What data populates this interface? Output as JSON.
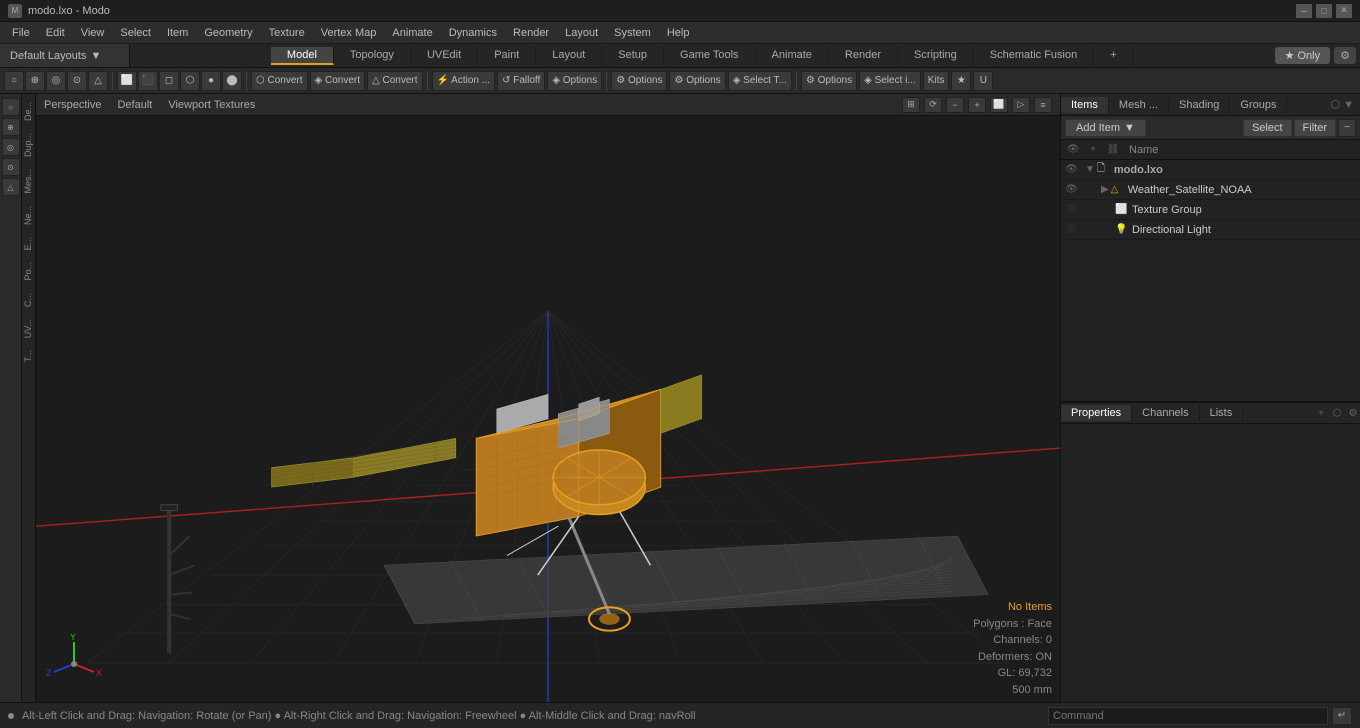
{
  "titlebar": {
    "icon": "☰",
    "title": "modo.lxo - Modo",
    "minimize": "─",
    "maximize": "□",
    "close": "✕"
  },
  "menubar": {
    "items": [
      "File",
      "Edit",
      "View",
      "Select",
      "Item",
      "Geometry",
      "Texture",
      "Vertex Map",
      "Animate",
      "Dynamics",
      "Render",
      "Layout",
      "System",
      "Help"
    ]
  },
  "layout_dropdown": {
    "label": "Default Layouts",
    "arrow": "▼"
  },
  "main_tabs": {
    "items": [
      "Model",
      "Topology",
      "UVEdit",
      "Paint",
      "Layout",
      "Setup",
      "Game Tools",
      "Animate",
      "Render",
      "Scripting",
      "Schematic Fusion"
    ],
    "active": "Model",
    "add_icon": "+",
    "only_label": "★  Only",
    "gear_label": "⚙"
  },
  "toolbar": {
    "groups": [
      {
        "buttons": [
          "○",
          "⊕",
          "◎",
          "⊙",
          "△"
        ]
      },
      {
        "buttons": [
          "⬜",
          "⬛",
          "◻",
          "⬡",
          "●",
          "⬤"
        ]
      },
      {
        "convert_buttons": [
          "Convert",
          "Convert",
          "Convert"
        ]
      },
      {
        "action_buttons": [
          "⚡ Action ...",
          "↺ Falloff",
          "◈ Options"
        ]
      },
      {
        "option_buttons": [
          "⚙ Options",
          "⚙ Options",
          "◈ Select T..."
        ]
      },
      {
        "right_buttons": [
          "⚙ Options",
          "◈ Select i...",
          "Kits",
          "★",
          "U"
        ]
      }
    ]
  },
  "viewport": {
    "perspective": "Perspective",
    "default_label": "Default",
    "viewport_textures": "Viewport Textures",
    "controls": [
      "⟳",
      "⊖",
      "⊕",
      "⬜",
      "▷",
      "⊞"
    ]
  },
  "scene_status": {
    "no_items": "No Items",
    "polygons": "Polygons : Face",
    "channels": "Channels: 0",
    "deformers": "Deformers: ON",
    "gl": "GL: 69,732",
    "size": "500 mm"
  },
  "nav_cube": {
    "x_label": "X",
    "y_label": "Y",
    "z_label": "Z"
  },
  "items_panel": {
    "tabs": [
      "Items",
      "Mesh ...",
      "Shading",
      "Groups"
    ],
    "active_tab": "Items",
    "add_item_label": "Add Item",
    "add_arrow": "▼",
    "select_label": "Select",
    "filter_label": "Filter",
    "col_name": "Name",
    "items": [
      {
        "depth": 0,
        "eye": true,
        "has_arrow": true,
        "arrow": "▼",
        "icon": "🗋",
        "label": "modo.lxo",
        "is_root": true
      },
      {
        "depth": 1,
        "eye": true,
        "has_arrow": true,
        "arrow": "▶",
        "icon": "🛰",
        "label": "Weather_Satellite_NOAA",
        "is_root": false
      },
      {
        "depth": 1,
        "eye": false,
        "has_arrow": false,
        "arrow": "",
        "icon": "⬜",
        "label": "Texture Group",
        "is_root": false
      },
      {
        "depth": 1,
        "eye": false,
        "has_arrow": false,
        "arrow": "",
        "icon": "💡",
        "label": "Directional Light",
        "is_root": false
      }
    ]
  },
  "properties_panel": {
    "tabs": [
      "Properties",
      "Channels",
      "Lists"
    ],
    "active_tab": "Properties",
    "add_icon": "+",
    "content": []
  },
  "status_bar": {
    "message": "Alt-Left Click and Drag: Navigation: Rotate (or Pan)  ●  Alt-Right Click and Drag: Navigation: Freewheel  ●  Alt-Middle Click and Drag: navRoll",
    "command_placeholder": "Command"
  }
}
